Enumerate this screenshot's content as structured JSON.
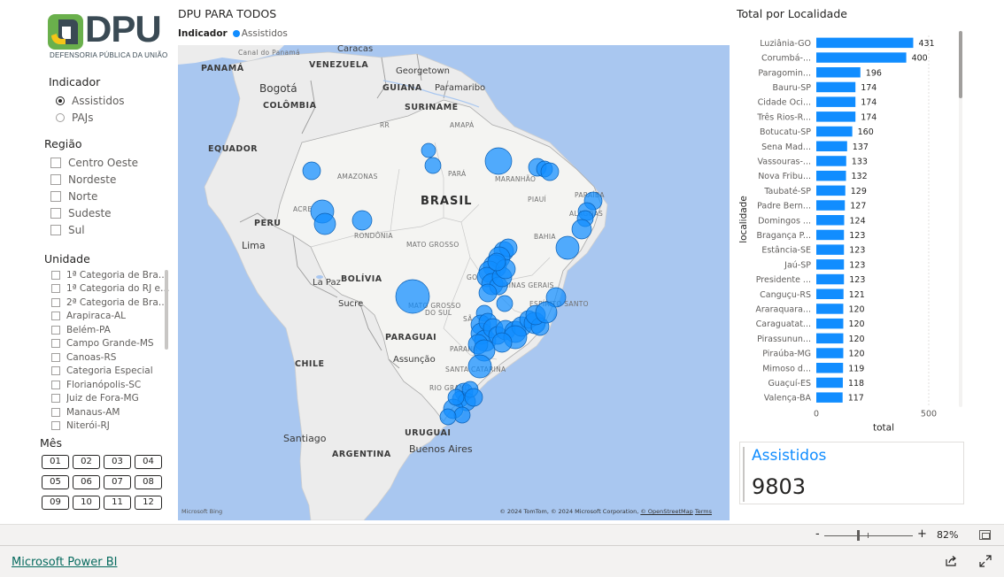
{
  "logo": {
    "text": "DPU",
    "subtitle": "DEFENSORIA PÚBLICA DA UNIÃO",
    "colors": {
      "green": "#6ab04c",
      "dark": "#3a4a54"
    }
  },
  "slicers": {
    "indicador": {
      "title": "Indicador",
      "options": [
        {
          "label": "Assistidos",
          "selected": true
        },
        {
          "label": "PAJs",
          "selected": false
        }
      ]
    },
    "regiao": {
      "title": "Região",
      "options": [
        "Centro Oeste",
        "Nordeste",
        "Norte",
        "Sudeste",
        "Sul"
      ]
    },
    "unidade": {
      "title": "Unidade",
      "options": [
        "1ª Categoria de Brasília",
        "1ª Categoria do RJ e do ES",
        "2ª Categoria de Brasília",
        "Arapiraca-AL",
        "Belém-PA",
        "Campo Grande-MS",
        "Canoas-RS",
        "Categoria Especial",
        "Florianópolis-SC",
        "Juiz de Fora-MG",
        "Manaus-AM",
        "Niterói-RJ"
      ]
    },
    "mes": {
      "title": "Mês",
      "options": [
        "01",
        "02",
        "03",
        "04",
        "05",
        "06",
        "07",
        "08",
        "09",
        "10",
        "11",
        "12"
      ]
    }
  },
  "map": {
    "title": "DPU PARA TODOS",
    "legend_title": "Indicador",
    "legend_item": "Assistidos",
    "bubble_color": "#118dff",
    "labels": {
      "caracas": "Caracas",
      "venezuela": "VENEZUELA",
      "georgetown": "Georgetown",
      "guiana": "GUIANA",
      "paramaribo": "Paramaribo",
      "suriname": "SURINAME",
      "bogota": "Bogotá",
      "colombia": "COLÔMBIA",
      "panama": "PANAMÁ",
      "canal": "Canal do Panamá",
      "equador": "EQUADOR",
      "peru": "PERU",
      "lima": "Lima",
      "bolivia": "BOLÍVIA",
      "lapaz": "La Paz",
      "sucre": "Sucre",
      "chile": "CHILE",
      "santiago": "Santiago",
      "argentina": "ARGENTINA",
      "buenosaires": "Buenos Aires",
      "uruguai": "URUGUAI",
      "paraguai": "PARAGUAI",
      "assuncao": "Assunção",
      "brasil": "BRASIL",
      "rr": "RR",
      "ap": "AMAPÁ",
      "amazonas": "AMAZONAS",
      "para": "PARÁ",
      "maranhao": "MARANHÃO",
      "piaui": "PIAUÍ",
      "bahia": "BAHIA",
      "acre": "ACRE",
      "rondonia": "RONDÔNIA",
      "matogrosso": "MATO GROSSO",
      "matogrossosul1": "MATO GROSSO",
      "matogrossosul2": "DO SUL",
      "minas": "MINAS GERAIS",
      "espirito": "ESPÍRITO SANTO",
      "parana": "PARANÁ",
      "santacatarina": "SANTA CATARINA",
      "riogrande": "RIO GRAND",
      "paraiba": "PARAÍBA",
      "alagoas": "ALAGOAS",
      "sp": "SÃ",
      "go": "GO"
    },
    "bing": "Microsoft Bing",
    "attribution": "© 2024 TomTom, © 2024 Microsoft Corporation,",
    "osm": "© OpenStreetMap",
    "terms": "Terms"
  },
  "bar_chart": {
    "title": "Total por Localidade",
    "bar_color": "#118dff",
    "chart_data": {
      "type": "bar",
      "orientation": "horizontal",
      "categories": [
        "Luziânia-GO",
        "Corumbá-...",
        "Paragomin...",
        "Bauru-SP",
        "Cidade Oci...",
        "Três Rios-R...",
        "Botucatu-SP",
        "Sena Mad...",
        "Vassouras-...",
        "Nova Fribu...",
        "Taubaté-SP",
        "Padre Bern...",
        "Domingos ...",
        "Bragança P...",
        "Estância-SE",
        "Jaú-SP",
        "Presidente ...",
        "Canguçu-RS",
        "Araraquara...",
        "Caraguatat...",
        "Pirassunun...",
        "Piraúba-MG",
        "Mimoso d...",
        "Guaçuí-ES",
        "Valença-BA"
      ],
      "values": [
        431,
        400,
        196,
        174,
        174,
        174,
        160,
        137,
        133,
        132,
        129,
        127,
        124,
        123,
        123,
        123,
        123,
        121,
        120,
        120,
        120,
        120,
        119,
        118,
        117
      ],
      "xlabel": "total",
      "ylabel": "localidade",
      "xlim": [
        0,
        500
      ],
      "xticks": [
        "0",
        "500"
      ]
    }
  },
  "card": {
    "label": "Assistidos",
    "value": "9803"
  },
  "status": {
    "zoom_minus": "-",
    "zoom_plus": "+",
    "zoom": "82%"
  },
  "footer": {
    "link": "Microsoft Power BI"
  }
}
